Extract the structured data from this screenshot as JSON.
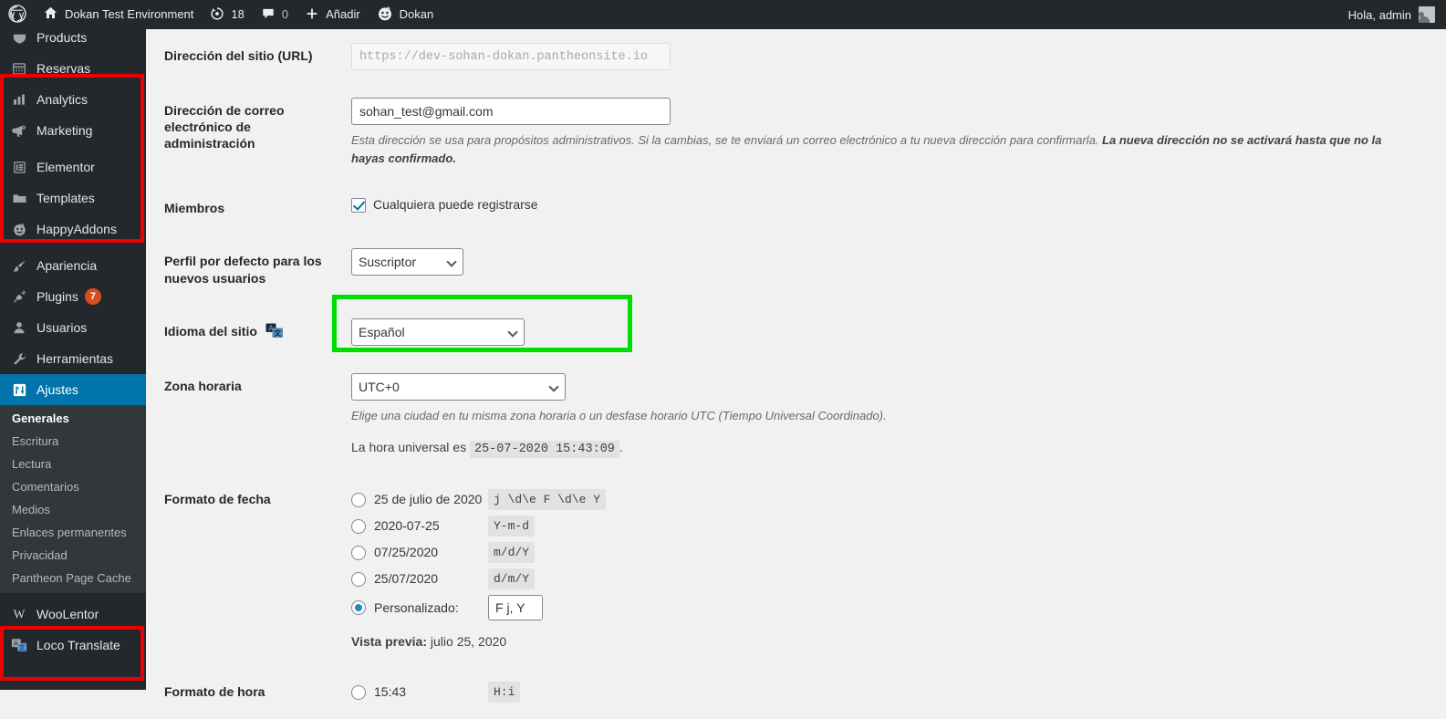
{
  "adminbar": {
    "wp_logo": "wordpress-logo-icon",
    "site_name": "Dokan Test Environment",
    "updates_icon": "updates-icon",
    "updates_count": "18",
    "comments_icon": "comments-bubble-icon",
    "comments_count": "0",
    "add_icon": "plus-icon",
    "add_label": "Añadir",
    "dokan_icon": "dokan-smiley-icon",
    "dokan_label": "Dokan",
    "greeting": "Hola, admin",
    "avatar": "user-avatar"
  },
  "sidebar": {
    "items": [
      {
        "label": "Products",
        "icon": "products-icon",
        "current": false
      },
      {
        "label": "Reservas",
        "icon": "calendar-icon",
        "current": false
      },
      {
        "label": "Analytics",
        "icon": "bar-chart-icon",
        "current": false
      },
      {
        "label": "Marketing",
        "icon": "megaphone-icon",
        "current": false
      },
      {
        "label": "Elementor",
        "icon": "elementor-icon",
        "current": false
      },
      {
        "label": "Templates",
        "icon": "folder-icon",
        "current": false
      },
      {
        "label": "HappyAddons",
        "icon": "happyaddons-smiley-icon",
        "current": false
      },
      {
        "label": "Apariencia",
        "icon": "paintbrush-icon",
        "current": false
      },
      {
        "label": "Plugins",
        "icon": "plug-icon",
        "current": false,
        "badge": "7"
      },
      {
        "label": "Usuarios",
        "icon": "user-icon",
        "current": false
      },
      {
        "label": "Herramientas",
        "icon": "wrench-icon",
        "current": false
      },
      {
        "label": "Ajustes",
        "icon": "settings-sliders-icon",
        "current": true
      }
    ],
    "submenu": [
      {
        "label": "Generales",
        "current": true
      },
      {
        "label": "Escritura",
        "current": false
      },
      {
        "label": "Lectura",
        "current": false
      },
      {
        "label": "Comentarios",
        "current": false
      },
      {
        "label": "Medios",
        "current": false
      },
      {
        "label": "Enlaces permanentes",
        "current": false
      },
      {
        "label": "Privacidad",
        "current": false
      },
      {
        "label": "Pantheon Page Cache",
        "current": false
      }
    ],
    "bottom_items": [
      {
        "label": "WooLentor",
        "icon": "woolentor-w-icon"
      },
      {
        "label": "Loco Translate",
        "icon": "loco-translate-icon"
      }
    ]
  },
  "settings": {
    "site_url": {
      "label": "Dirección del sitio (URL)",
      "value": "https://dev-sohan-dokan.pantheonsite.io"
    },
    "admin_email": {
      "label": "Dirección de correo electrónico de administración",
      "value": "sohan_test@gmail.com",
      "description_normal": "Esta dirección se usa para propósitos administrativos. Si la cambias, se te enviará un correo electrónico a tu nueva dirección para confirmarla. ",
      "description_bold": "La nueva dirección no se activará hasta que no la hayas confirmado."
    },
    "membership": {
      "label": "Miembros",
      "checkbox_label": "Cualquiera puede registrarse",
      "checked": true
    },
    "default_role": {
      "label": "Perfil por defecto para los nuevos usuarios",
      "value": "Suscriptor"
    },
    "site_language": {
      "label": "Idioma del sitio",
      "icon": "translation-flag-icon",
      "value": "Español"
    },
    "timezone": {
      "label": "Zona horaria",
      "value": "UTC+0",
      "description": "Elige una ciudad en tu misma zona horaria o un desfase horario UTC (Tiempo Universal Coordinado).",
      "utc_prefix": "La hora universal es",
      "utc_value": "25-07-2020 15:43:09",
      "utc_suffix": "."
    },
    "date_format": {
      "label": "Formato de fecha",
      "options": [
        {
          "display": "25 de julio de 2020",
          "code": "j \\d\\e F \\d\\e Y",
          "selected": false
        },
        {
          "display": "2020-07-25",
          "code": "Y-m-d",
          "selected": false
        },
        {
          "display": "07/25/2020",
          "code": "m/d/Y",
          "selected": false
        },
        {
          "display": "25/07/2020",
          "code": "d/m/Y",
          "selected": false
        }
      ],
      "custom_label": "Personalizado:",
      "custom_value": "F j, Y",
      "custom_selected": true,
      "preview_label": "Vista previa:",
      "preview_value": "julio 25, 2020"
    },
    "time_format": {
      "label": "Formato de hora",
      "options": [
        {
          "display": "15:43",
          "code": "H:i",
          "selected": false
        }
      ]
    }
  },
  "annotations": {
    "red_box_top": "highlight-sidebar-plugins-group",
    "red_box_bottom": "highlight-sidebar-translate-group",
    "green_box": "highlight-site-language-select",
    "red_color": "#ee0000",
    "green_color": "#00dd00"
  }
}
